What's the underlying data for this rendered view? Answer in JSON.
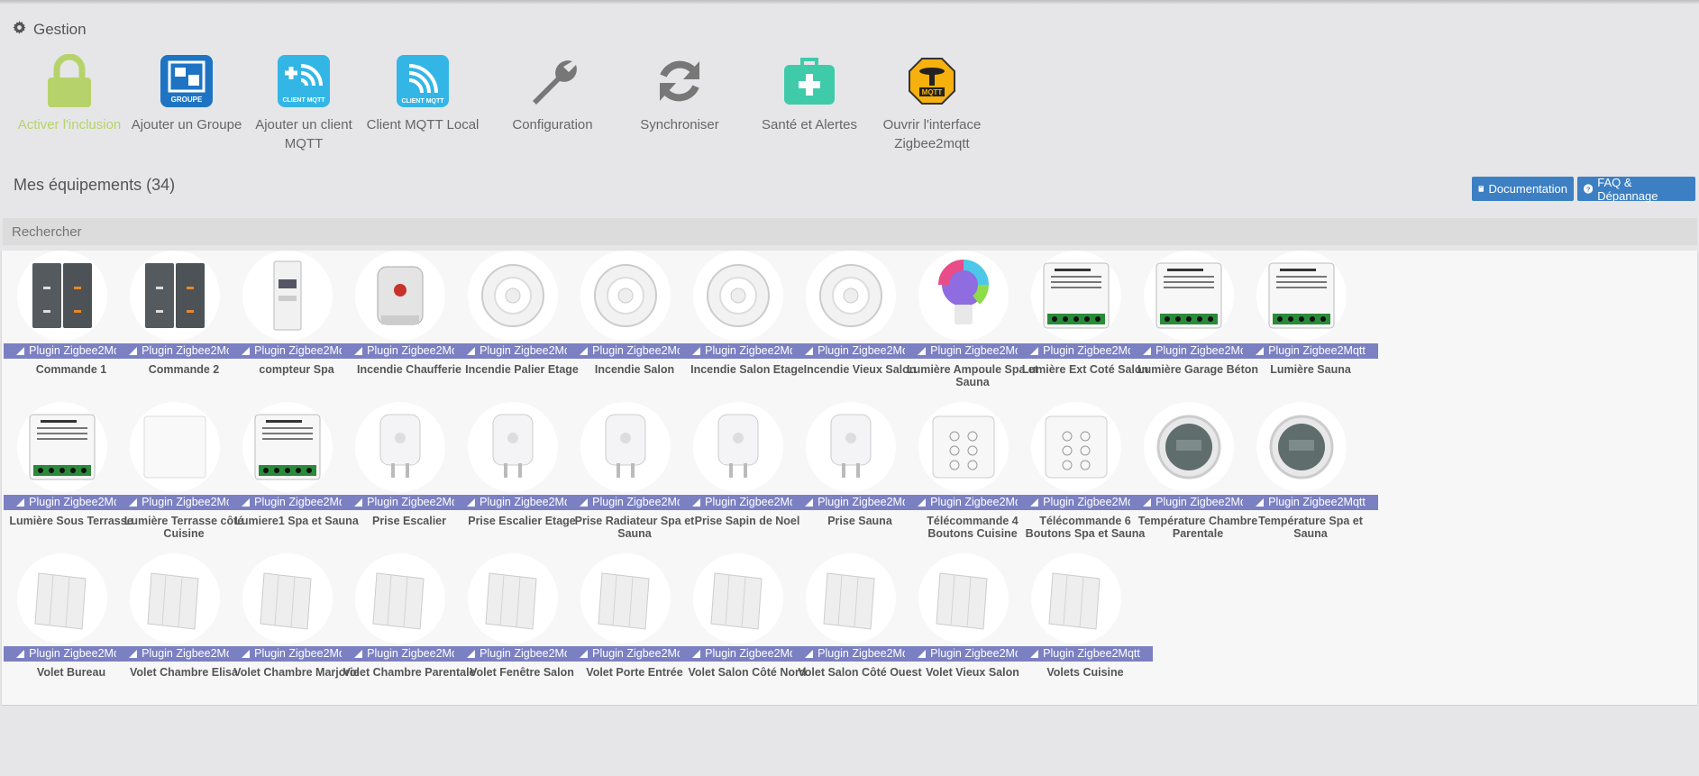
{
  "section": {
    "title": "Gestion",
    "icon": "gear-icon"
  },
  "actions": [
    {
      "label": "Activer l'inclusion",
      "icon": "lock-icon",
      "color": "#b6d36b"
    },
    {
      "label": "Ajouter un Groupe",
      "icon": "groupe-icon",
      "color": "#1e74c3",
      "badge": "GROUPE"
    },
    {
      "label": "Ajouter un client MQTT",
      "icon": "add-client-mqtt-icon",
      "color": "#33b6e6",
      "badge": "CLIENT MQTT"
    },
    {
      "label": "Client MQTT Local",
      "icon": "client-mqtt-icon",
      "color": "#33b6e6",
      "badge": "CLIENT MQTT"
    },
    {
      "label": "Configuration",
      "icon": "wrench-icon",
      "color": "#777777"
    },
    {
      "label": "Synchroniser",
      "icon": "sync-icon",
      "color": "#777777"
    },
    {
      "label": "Santé et Alertes",
      "icon": "medkit-icon",
      "color": "#3fcbaa"
    },
    {
      "label": "Ouvrir l'interface Zigbee2mqtt",
      "icon": "zigbee2mqtt-icon",
      "color": "#f6b10f",
      "badge": "MQTT"
    }
  ],
  "equipment": {
    "title": "Mes équipements (34)",
    "doc_label": "Documentation",
    "faq_label": "FAQ & Dépannage",
    "search_placeholder": "Rechercher",
    "plugin_label": "Plugin Zigbee2Mqtt",
    "items": [
      {
        "name": "Commande 1",
        "type": "panel"
      },
      {
        "name": "Commande 2",
        "type": "panel"
      },
      {
        "name": "compteur Spa",
        "type": "meter"
      },
      {
        "name": "Incendie Chaufferie",
        "type": "siren"
      },
      {
        "name": "Incendie Palier Etage",
        "type": "smoke"
      },
      {
        "name": "Incendie Salon",
        "type": "smoke"
      },
      {
        "name": "Incendie Salon Etage",
        "type": "smoke"
      },
      {
        "name": "Incendie Vieux Salon",
        "type": "smoke"
      },
      {
        "name": "Lumière Ampoule Spa et Sauna",
        "type": "bulb"
      },
      {
        "name": "Lumière Ext Coté Salon",
        "type": "module"
      },
      {
        "name": "Lumière Garage Béton",
        "type": "module"
      },
      {
        "name": "Lumière Sauna",
        "type": "module"
      },
      {
        "name": "Lumière Sous Terrasse",
        "type": "module"
      },
      {
        "name": "Lumière Terrasse côté Cuisine",
        "type": "blank"
      },
      {
        "name": "Lumiere1 Spa et Sauna",
        "type": "module"
      },
      {
        "name": "Prise Escalier",
        "type": "plug"
      },
      {
        "name": "Prise Escalier Etage",
        "type": "plug"
      },
      {
        "name": "Prise Radiateur Spa et Sauna",
        "type": "plug"
      },
      {
        "name": "Prise Sapin de Noel",
        "type": "plug"
      },
      {
        "name": "Prise Sauna",
        "type": "plug"
      },
      {
        "name": "Télécommande 4 Boutons Cuisine",
        "type": "remote"
      },
      {
        "name": "Télécommande 6 Boutons Spa et Sauna",
        "type": "remote"
      },
      {
        "name": "Température Chambre Parentale",
        "type": "thermo"
      },
      {
        "name": "Température Spa et Sauna",
        "type": "thermo"
      },
      {
        "name": "Volet Bureau",
        "type": "shutter"
      },
      {
        "name": "Volet Chambre Elisa",
        "type": "shutter"
      },
      {
        "name": "Volet Chambre Marjorie",
        "type": "shutter"
      },
      {
        "name": "Volet Chambre Parentale",
        "type": "shutter"
      },
      {
        "name": "Volet Fenêtre Salon",
        "type": "shutter"
      },
      {
        "name": "Volet Porte Entrée",
        "type": "shutter"
      },
      {
        "name": "Volet Salon Côté Nord",
        "type": "shutter"
      },
      {
        "name": "Volet Salon Côté Ouest",
        "type": "shutter"
      },
      {
        "name": "Volet Vieux Salon",
        "type": "shutter"
      },
      {
        "name": "Volets Cuisine",
        "type": "shutter"
      }
    ]
  }
}
